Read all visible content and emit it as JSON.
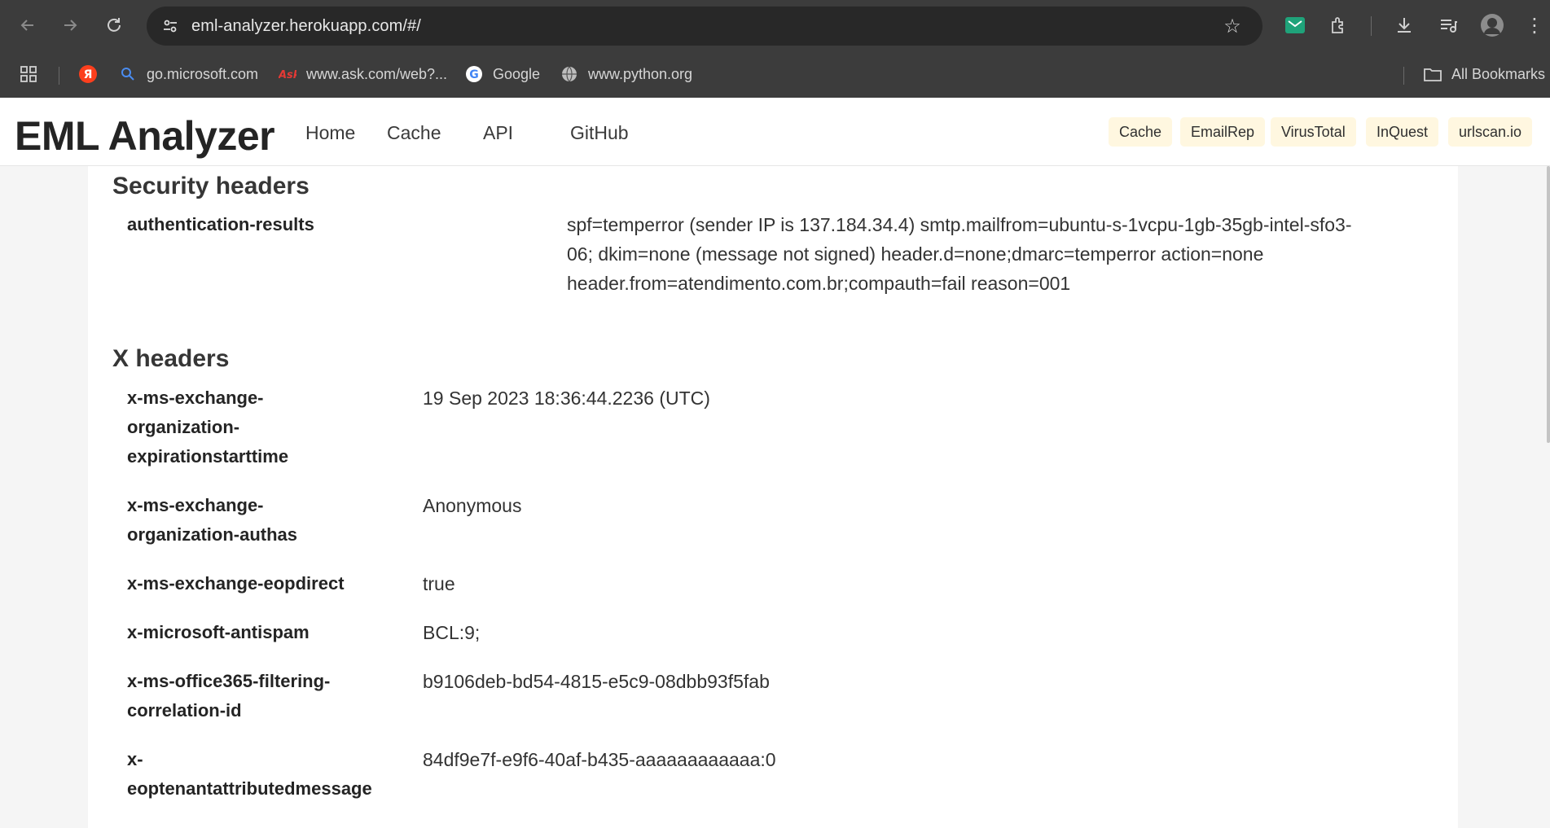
{
  "browser": {
    "url": "eml-analyzer.herokuapp.com/#/",
    "bookmarks": [
      {
        "label": "go.microsoft.com",
        "icon": "search-icon"
      },
      {
        "label": "www.ask.com/web?...",
        "icon": "ask-icon"
      },
      {
        "label": "Google",
        "icon": "google-icon"
      },
      {
        "label": "www.python.org",
        "icon": "globe-icon"
      }
    ],
    "all_bookmarks_label": "All Bookmarks"
  },
  "navbar": {
    "brand": "EML Analyzer",
    "links": [
      "Home",
      "Cache",
      "API",
      "GitHub"
    ],
    "pills": [
      "Cache",
      "EmailRep",
      "VirusTotal",
      "InQuest",
      "urlscan.io"
    ]
  },
  "security_headers": {
    "title": "Security headers",
    "rows": [
      {
        "key": "authentication-results",
        "value_lines": [
          "spf=temperror (sender IP is 137.184.34.4) smtp.mailfrom=ubuntu-s-1vcpu-1gb-35gb-intel-sfo3-",
          "06; dkim=none (message not signed) header.d=none;dmarc=temperror action=none",
          "header.from=atendimento.com.br;compauth=fail reason=001"
        ]
      }
    ]
  },
  "x_headers": {
    "title": "X headers",
    "rows": [
      {
        "key_lines": [
          "x-ms-exchange-",
          "organization-",
          "expirationstarttime"
        ],
        "value": "19 Sep 2023 18:36:44.2236 (UTC)"
      },
      {
        "key_lines": [
          "x-ms-exchange-",
          "organization-authas"
        ],
        "value": "Anonymous"
      },
      {
        "key_lines": [
          "x-ms-exchange-eopdirect"
        ],
        "value": "true"
      },
      {
        "key_lines": [
          "x-microsoft-antispam"
        ],
        "value": "BCL:9;"
      },
      {
        "key_lines": [
          "x-ms-office365-filtering-",
          "correlation-id"
        ],
        "value": "b9106deb-bd54-4815-e5c9-08dbb93f5fab"
      },
      {
        "key_lines": [
          "x-",
          "eoptenantattributedmessage"
        ],
        "value": "84df9e7f-e9f6-40af-b435-aaaaaaaaaaaa:0"
      }
    ]
  },
  "colors": {
    "chrome_bg": "#3c3c3c",
    "omnibox_bg": "#282828",
    "pill_bg": "#fff7e0",
    "page_bg": "#f5f5f5"
  }
}
